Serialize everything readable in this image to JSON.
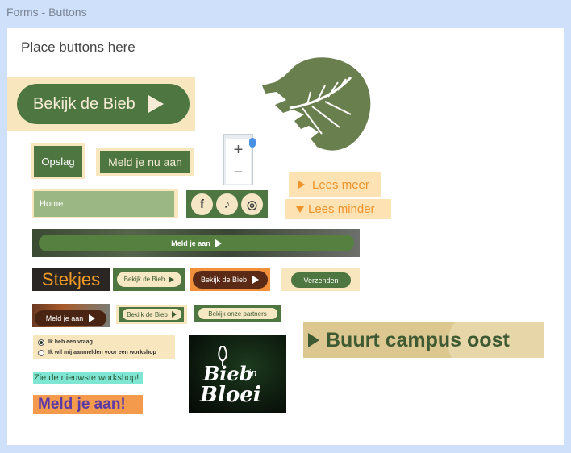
{
  "window": {
    "title": "Forms - Buttons"
  },
  "canvas": {
    "heading": "Place buttons here"
  },
  "buttons": {
    "bekijk_large": "Bekijk de Bieb",
    "opslag": "Opslag",
    "meld_nu": "Meld je nu aan",
    "lees_meer": "Lees meer",
    "lees_minder": "Lees minder",
    "home": "Home",
    "banner_meld": "Meld je aan",
    "stekjes": "Stekjes",
    "bekijk_small_1": "Bekijk de Bieb",
    "bekijk_small_2": "Bekijk de Bieb",
    "verzenden": "Verzenden",
    "meld_small": "Meld je aan",
    "bekijk_small_3": "Bekijk de Bieb",
    "partners": "Bekijk onze partners",
    "buurt": "Buurt campus oost",
    "zie": "Zie de nieuwste workshop!",
    "meld_big": "Meld je aan!"
  },
  "map_zoom": {
    "zoom_in": "+",
    "zoom_out": "−"
  },
  "social": {
    "facebook": "f",
    "tiktok": "♪",
    "instagram": "◎"
  },
  "radio_group": {
    "options": [
      "Ik heb een vraag",
      "Ik wil mij aanmelden voor een workshop"
    ],
    "selected": 0
  },
  "logo": {
    "line1": "Bieb",
    "line2": "in",
    "line3": "Bloei"
  },
  "colors": {
    "brand_green": "#4e7641",
    "cream": "#f8e6bf",
    "orange": "#f0932a"
  }
}
